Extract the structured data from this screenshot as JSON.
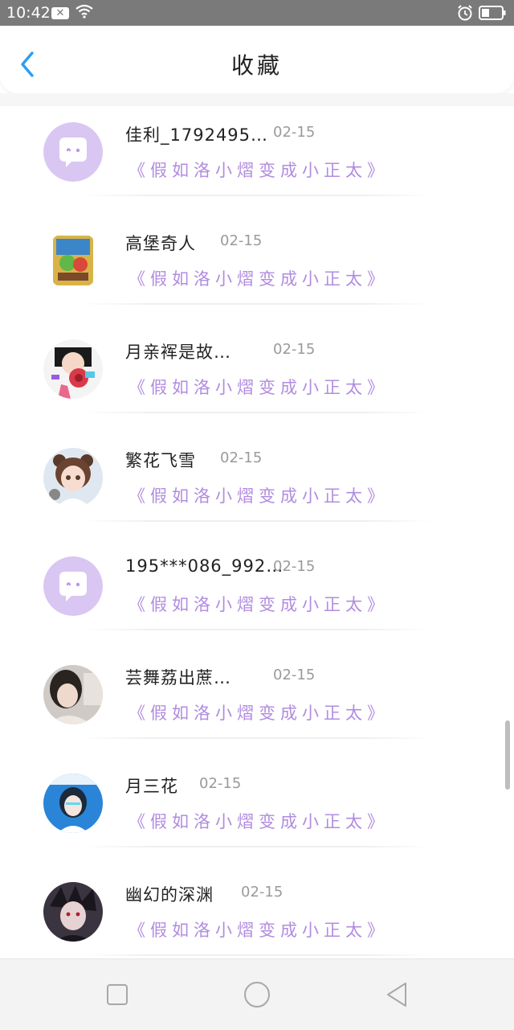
{
  "status_bar": {
    "time": "10:42",
    "notification_icon": "close-box-icon",
    "wifi_icon": "wifi-icon",
    "alarm_icon": "alarm-icon",
    "battery_icon": "battery-icon"
  },
  "header": {
    "title": "收藏",
    "back_icon": "chevron-left-icon",
    "accent_color": "#2a9df4"
  },
  "favorites": {
    "items": [
      {
        "name": "佳利_1792495…",
        "date": "02-15",
        "story": "《假如洛小熠变成小正太》",
        "avatar": "default-chat-avatar"
      },
      {
        "name": "高堡奇人",
        "date": "02-15",
        "story": "《假如洛小熠变成小正太》",
        "avatar": "user-avatar"
      },
      {
        "name": "月亲裈是故…",
        "date": "02-15",
        "story": "《假如洛小熠变成小正太》",
        "avatar": "user-avatar"
      },
      {
        "name": "繁花飞雪",
        "date": "02-15",
        "story": "《假如洛小熠变成小正太》",
        "avatar": "user-avatar"
      },
      {
        "name": "195***086_992…",
        "date": "02-15",
        "story": "《假如洛小熠变成小正太》",
        "avatar": "default-chat-avatar"
      },
      {
        "name": "芸舞荔出蔗…",
        "date": "02-15",
        "story": "《假如洛小熠变成小正太》",
        "avatar": "user-avatar"
      },
      {
        "name": "月三花",
        "date": "02-15",
        "story": "《假如洛小熠变成小正太》",
        "avatar": "user-avatar"
      },
      {
        "name": "幽幻的深渊",
        "date": "02-15",
        "story": "《假如洛小熠变成小正太》",
        "avatar": "user-avatar"
      }
    ],
    "story_color": "#b18ce0",
    "default_avatar_color": "#d9c6f2"
  },
  "nav_bar": {
    "recent_icon": "square-icon",
    "home_icon": "circle-icon",
    "back_icon": "triangle-back-icon"
  }
}
